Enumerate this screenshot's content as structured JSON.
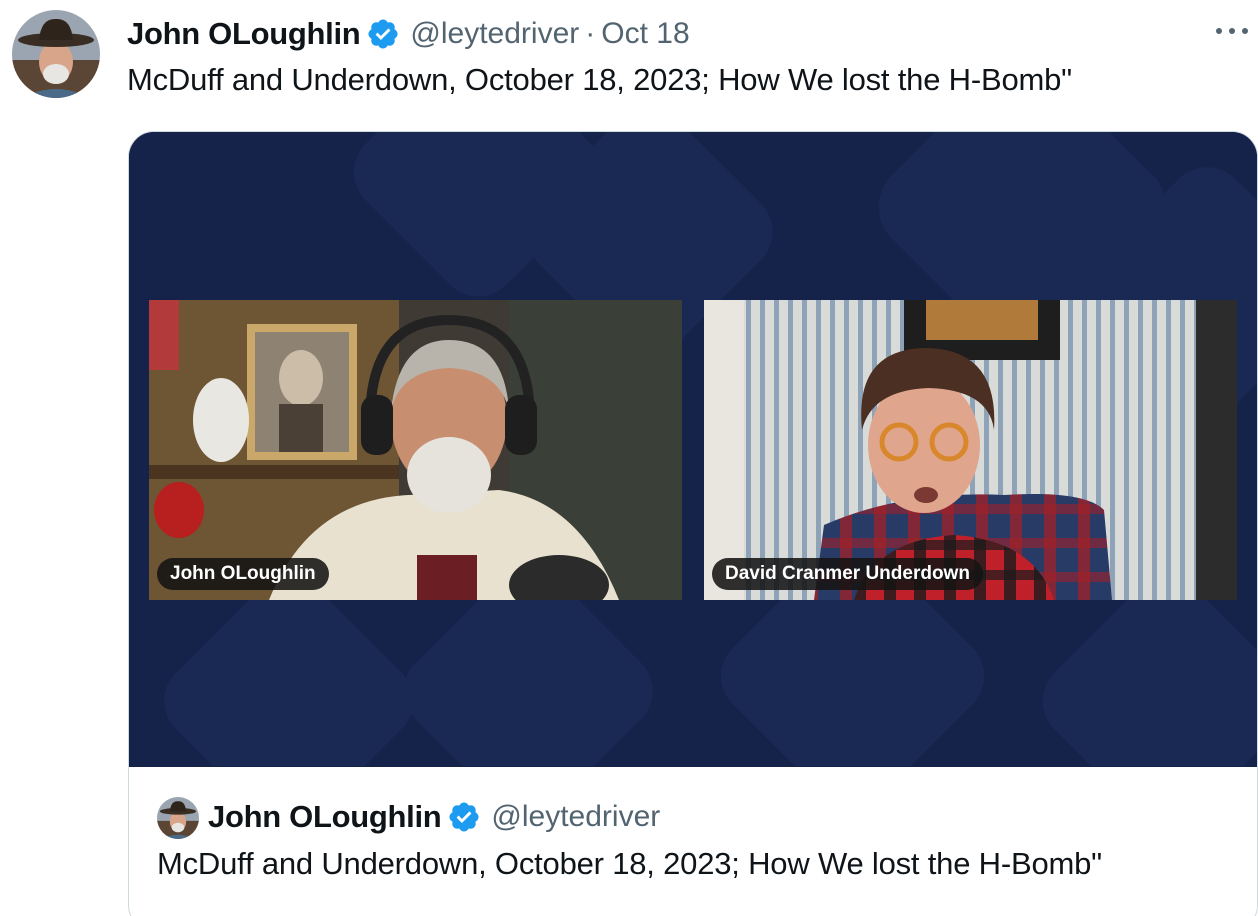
{
  "tweet": {
    "author_name": "John OLoughlin",
    "handle": "@leytedriver",
    "separator": "·",
    "date": "Oct 18",
    "text": "McDuff and Underdown, October 18, 2023; How We lost the H-Bomb\"",
    "avatar_icon": "avatar-cowboy-hat",
    "verified_icon": "verified-badge-icon",
    "more_icon": "more-options-icon"
  },
  "media": {
    "participants": [
      {
        "label": "John OLoughlin"
      },
      {
        "label": "David Cranmer Underdown"
      }
    ],
    "background_color": "#15234a"
  },
  "quoted_tweet": {
    "author_name": "John OLoughlin",
    "handle": "@leytedriver",
    "text": "McDuff and Underdown, October 18, 2023; How We lost the H-Bomb\""
  },
  "colors": {
    "verified": "#1d9bf0",
    "secondary_text": "#536471",
    "border": "#cfd9de"
  }
}
